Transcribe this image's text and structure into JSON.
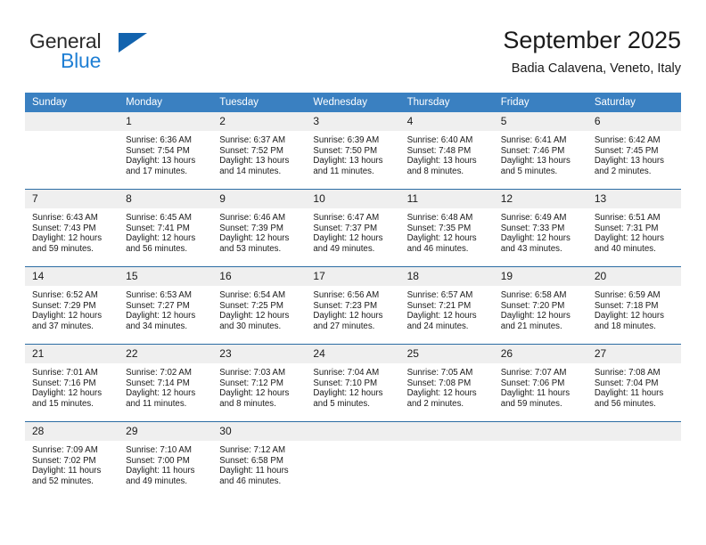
{
  "brand": {
    "name_part1": "General",
    "name_part2": "Blue",
    "triangle_color": "#1263ae",
    "blue_color": "#1f7fd4"
  },
  "header": {
    "title": "September 2025",
    "subtitle": "Badia Calavena, Veneto, Italy"
  },
  "theme": {
    "header_row_bg": "#3a80c1",
    "daynum_bg": "#efefef",
    "cell_border": "#2b6ca3"
  },
  "weekdays": [
    "Sunday",
    "Monday",
    "Tuesday",
    "Wednesday",
    "Thursday",
    "Friday",
    "Saturday"
  ],
  "weeks": [
    [
      {
        "day": "",
        "sunrise": "",
        "sunset": "",
        "daylight_line1": "",
        "daylight_line2": ""
      },
      {
        "day": "1",
        "sunrise": "Sunrise: 6:36 AM",
        "sunset": "Sunset: 7:54 PM",
        "daylight_line1": "Daylight: 13 hours",
        "daylight_line2": "and 17 minutes."
      },
      {
        "day": "2",
        "sunrise": "Sunrise: 6:37 AM",
        "sunset": "Sunset: 7:52 PM",
        "daylight_line1": "Daylight: 13 hours",
        "daylight_line2": "and 14 minutes."
      },
      {
        "day": "3",
        "sunrise": "Sunrise: 6:39 AM",
        "sunset": "Sunset: 7:50 PM",
        "daylight_line1": "Daylight: 13 hours",
        "daylight_line2": "and 11 minutes."
      },
      {
        "day": "4",
        "sunrise": "Sunrise: 6:40 AM",
        "sunset": "Sunset: 7:48 PM",
        "daylight_line1": "Daylight: 13 hours",
        "daylight_line2": "and 8 minutes."
      },
      {
        "day": "5",
        "sunrise": "Sunrise: 6:41 AM",
        "sunset": "Sunset: 7:46 PM",
        "daylight_line1": "Daylight: 13 hours",
        "daylight_line2": "and 5 minutes."
      },
      {
        "day": "6",
        "sunrise": "Sunrise: 6:42 AM",
        "sunset": "Sunset: 7:45 PM",
        "daylight_line1": "Daylight: 13 hours",
        "daylight_line2": "and 2 minutes."
      }
    ],
    [
      {
        "day": "7",
        "sunrise": "Sunrise: 6:43 AM",
        "sunset": "Sunset: 7:43 PM",
        "daylight_line1": "Daylight: 12 hours",
        "daylight_line2": "and 59 minutes."
      },
      {
        "day": "8",
        "sunrise": "Sunrise: 6:45 AM",
        "sunset": "Sunset: 7:41 PM",
        "daylight_line1": "Daylight: 12 hours",
        "daylight_line2": "and 56 minutes."
      },
      {
        "day": "9",
        "sunrise": "Sunrise: 6:46 AM",
        "sunset": "Sunset: 7:39 PM",
        "daylight_line1": "Daylight: 12 hours",
        "daylight_line2": "and 53 minutes."
      },
      {
        "day": "10",
        "sunrise": "Sunrise: 6:47 AM",
        "sunset": "Sunset: 7:37 PM",
        "daylight_line1": "Daylight: 12 hours",
        "daylight_line2": "and 49 minutes."
      },
      {
        "day": "11",
        "sunrise": "Sunrise: 6:48 AM",
        "sunset": "Sunset: 7:35 PM",
        "daylight_line1": "Daylight: 12 hours",
        "daylight_line2": "and 46 minutes."
      },
      {
        "day": "12",
        "sunrise": "Sunrise: 6:49 AM",
        "sunset": "Sunset: 7:33 PM",
        "daylight_line1": "Daylight: 12 hours",
        "daylight_line2": "and 43 minutes."
      },
      {
        "day": "13",
        "sunrise": "Sunrise: 6:51 AM",
        "sunset": "Sunset: 7:31 PM",
        "daylight_line1": "Daylight: 12 hours",
        "daylight_line2": "and 40 minutes."
      }
    ],
    [
      {
        "day": "14",
        "sunrise": "Sunrise: 6:52 AM",
        "sunset": "Sunset: 7:29 PM",
        "daylight_line1": "Daylight: 12 hours",
        "daylight_line2": "and 37 minutes."
      },
      {
        "day": "15",
        "sunrise": "Sunrise: 6:53 AM",
        "sunset": "Sunset: 7:27 PM",
        "daylight_line1": "Daylight: 12 hours",
        "daylight_line2": "and 34 minutes."
      },
      {
        "day": "16",
        "sunrise": "Sunrise: 6:54 AM",
        "sunset": "Sunset: 7:25 PM",
        "daylight_line1": "Daylight: 12 hours",
        "daylight_line2": "and 30 minutes."
      },
      {
        "day": "17",
        "sunrise": "Sunrise: 6:56 AM",
        "sunset": "Sunset: 7:23 PM",
        "daylight_line1": "Daylight: 12 hours",
        "daylight_line2": "and 27 minutes."
      },
      {
        "day": "18",
        "sunrise": "Sunrise: 6:57 AM",
        "sunset": "Sunset: 7:21 PM",
        "daylight_line1": "Daylight: 12 hours",
        "daylight_line2": "and 24 minutes."
      },
      {
        "day": "19",
        "sunrise": "Sunrise: 6:58 AM",
        "sunset": "Sunset: 7:20 PM",
        "daylight_line1": "Daylight: 12 hours",
        "daylight_line2": "and 21 minutes."
      },
      {
        "day": "20",
        "sunrise": "Sunrise: 6:59 AM",
        "sunset": "Sunset: 7:18 PM",
        "daylight_line1": "Daylight: 12 hours",
        "daylight_line2": "and 18 minutes."
      }
    ],
    [
      {
        "day": "21",
        "sunrise": "Sunrise: 7:01 AM",
        "sunset": "Sunset: 7:16 PM",
        "daylight_line1": "Daylight: 12 hours",
        "daylight_line2": "and 15 minutes."
      },
      {
        "day": "22",
        "sunrise": "Sunrise: 7:02 AM",
        "sunset": "Sunset: 7:14 PM",
        "daylight_line1": "Daylight: 12 hours",
        "daylight_line2": "and 11 minutes."
      },
      {
        "day": "23",
        "sunrise": "Sunrise: 7:03 AM",
        "sunset": "Sunset: 7:12 PM",
        "daylight_line1": "Daylight: 12 hours",
        "daylight_line2": "and 8 minutes."
      },
      {
        "day": "24",
        "sunrise": "Sunrise: 7:04 AM",
        "sunset": "Sunset: 7:10 PM",
        "daylight_line1": "Daylight: 12 hours",
        "daylight_line2": "and 5 minutes."
      },
      {
        "day": "25",
        "sunrise": "Sunrise: 7:05 AM",
        "sunset": "Sunset: 7:08 PM",
        "daylight_line1": "Daylight: 12 hours",
        "daylight_line2": "and 2 minutes."
      },
      {
        "day": "26",
        "sunrise": "Sunrise: 7:07 AM",
        "sunset": "Sunset: 7:06 PM",
        "daylight_line1": "Daylight: 11 hours",
        "daylight_line2": "and 59 minutes."
      },
      {
        "day": "27",
        "sunrise": "Sunrise: 7:08 AM",
        "sunset": "Sunset: 7:04 PM",
        "daylight_line1": "Daylight: 11 hours",
        "daylight_line2": "and 56 minutes."
      }
    ],
    [
      {
        "day": "28",
        "sunrise": "Sunrise: 7:09 AM",
        "sunset": "Sunset: 7:02 PM",
        "daylight_line1": "Daylight: 11 hours",
        "daylight_line2": "and 52 minutes."
      },
      {
        "day": "29",
        "sunrise": "Sunrise: 7:10 AM",
        "sunset": "Sunset: 7:00 PM",
        "daylight_line1": "Daylight: 11 hours",
        "daylight_line2": "and 49 minutes."
      },
      {
        "day": "30",
        "sunrise": "Sunrise: 7:12 AM",
        "sunset": "Sunset: 6:58 PM",
        "daylight_line1": "Daylight: 11 hours",
        "daylight_line2": "and 46 minutes."
      },
      {
        "day": "",
        "sunrise": "",
        "sunset": "",
        "daylight_line1": "",
        "daylight_line2": ""
      },
      {
        "day": "",
        "sunrise": "",
        "sunset": "",
        "daylight_line1": "",
        "daylight_line2": ""
      },
      {
        "day": "",
        "sunrise": "",
        "sunset": "",
        "daylight_line1": "",
        "daylight_line2": ""
      },
      {
        "day": "",
        "sunrise": "",
        "sunset": "",
        "daylight_line1": "",
        "daylight_line2": ""
      }
    ]
  ]
}
